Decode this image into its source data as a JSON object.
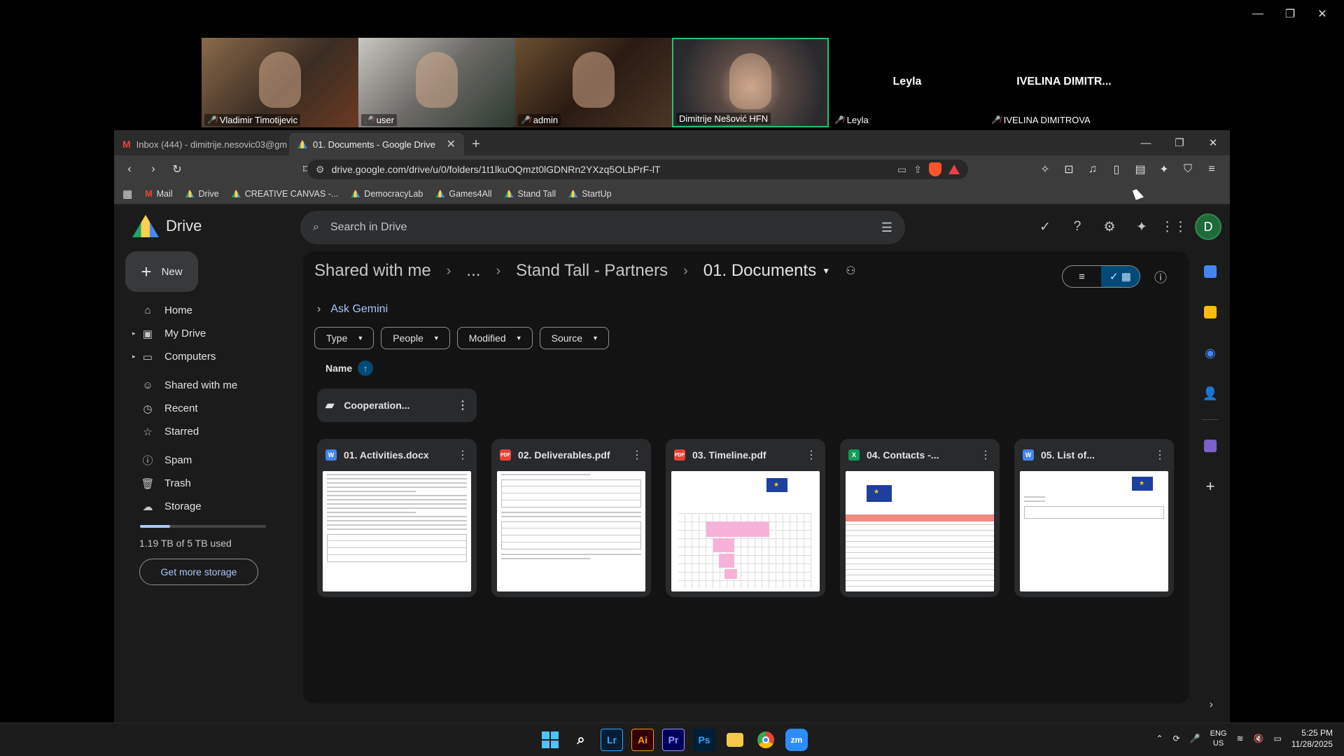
{
  "participants": [
    {
      "name": "Vladimir Timotijevic",
      "kind": "video",
      "muted": true
    },
    {
      "name": "user",
      "kind": "video",
      "muted": true
    },
    {
      "name": "admin",
      "kind": "video",
      "muted": true
    },
    {
      "name": "Dimitrije Nešović HFN",
      "kind": "video-active",
      "muted": false
    },
    {
      "name": "Leyla",
      "display": "Leyla",
      "kind": "avatar",
      "muted": true
    },
    {
      "name": "IVELINA DIMITROVA",
      "display": "IVELINA DIMITR...",
      "kind": "avatar",
      "muted": true
    }
  ],
  "browser": {
    "tabs": [
      {
        "title": "Inbox (444) - dimitrije.nesovic03@gm",
        "icon": "gmail-icon"
      },
      {
        "title": "01. Documents - Google Drive",
        "icon": "drive-icon",
        "active": true
      }
    ],
    "url": "drive.google.com/drive/u/0/folders/1t1lkuOQmzt0lGDNRn2YXzq5OLbPrF-lT",
    "brave_count": "4",
    "bookmarks": [
      "Mail",
      "Drive",
      "CREATIVE CANVAS -...",
      "DemocracyLab",
      "Games4All",
      "Stand Tall",
      "StartUp"
    ]
  },
  "drive": {
    "app_name": "Drive",
    "search_placeholder": "Search in Drive",
    "avatar_letter": "D",
    "new_label": "New",
    "nav": [
      {
        "label": "Home",
        "icon": "home-icon",
        "glyph": "⌂"
      },
      {
        "label": "My Drive",
        "icon": "my-drive-icon",
        "glyph": "▣",
        "caret": true
      },
      {
        "label": "Computers",
        "icon": "computer-icon",
        "glyph": "▭",
        "caret": true
      },
      {
        "label": "Shared with me",
        "icon": "people-icon",
        "glyph": "☺",
        "group_start": true
      },
      {
        "label": "Recent",
        "icon": "clock-icon",
        "glyph": "◷"
      },
      {
        "label": "Starred",
        "icon": "star-icon",
        "glyph": "☆"
      },
      {
        "label": "Spam",
        "icon": "spam-icon",
        "glyph": "ⓘ",
        "group_start": true
      },
      {
        "label": "Trash",
        "icon": "trash-icon",
        "glyph": "🗑"
      },
      {
        "label": "Storage",
        "icon": "cloud-icon",
        "glyph": "☁"
      }
    ],
    "storage_used_fraction": 0.24,
    "storage_text": "1.19 TB of 5 TB used",
    "get_storage_label": "Get more storage",
    "breadcrumbs": [
      "Shared with me",
      "...",
      "Stand Tall - Partners",
      "01. Documents"
    ],
    "ask_gemini": "Ask Gemini",
    "filters": [
      "Type",
      "People",
      "Modified",
      "Source"
    ],
    "sort_label": "Name",
    "folders": [
      {
        "name": "Cooperation..."
      }
    ],
    "files": [
      {
        "name": "01. Activities.docx",
        "type": "W",
        "kind": "doc"
      },
      {
        "name": "02. Deliverables.pdf",
        "type": "PDF",
        "kind": "pdf"
      },
      {
        "name": "03. Timeline.pdf",
        "type": "PDF",
        "kind": "timeline"
      },
      {
        "name": "04. Contacts -...",
        "type": "X",
        "kind": "sheet"
      },
      {
        "name": "05. List of...",
        "type": "W",
        "kind": "list"
      }
    ]
  },
  "taskbar": {
    "apps": [
      "Windows",
      "Search",
      "Lr",
      "Ai",
      "Pr",
      "Ps",
      "File Explorer",
      "Chrome",
      "Zoom"
    ],
    "lang_top": "ENG",
    "lang_bottom": "US",
    "time": "5:25 PM",
    "date": "11/28/2025"
  }
}
